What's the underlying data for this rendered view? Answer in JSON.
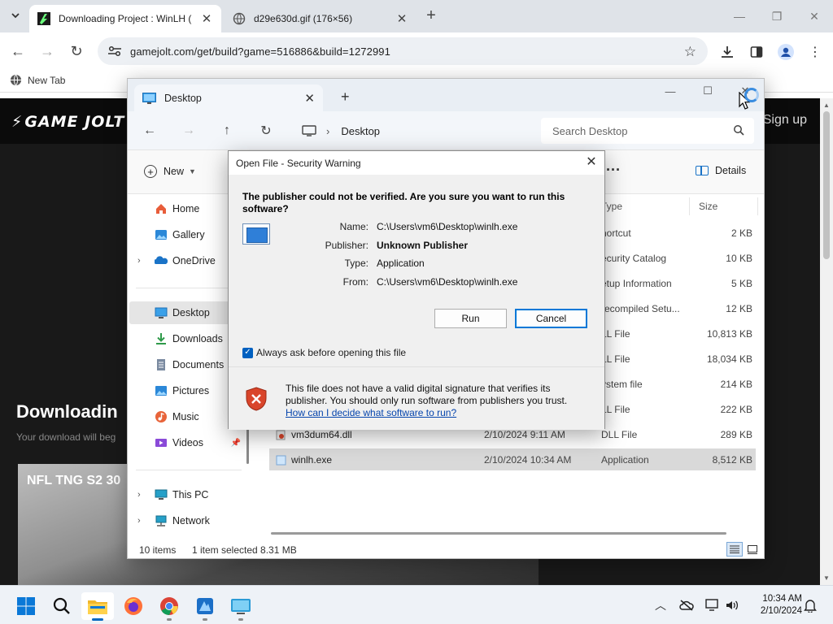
{
  "browser": {
    "tabs": [
      {
        "title": "Downloading Project : WinLH (",
        "active": true,
        "favicon": "gamejolt-icon"
      },
      {
        "title": "d29e630d.gif (176×56)",
        "active": false,
        "favicon": "globe-icon"
      }
    ],
    "url": "gamejolt.com/get/build?game=516886&build=1272991",
    "bookmarks": [
      "New Tab"
    ]
  },
  "webpage": {
    "logo": "GAME JOLT",
    "signin": "Sign up",
    "heading": "Downloadin",
    "subtitle": "Your download will beg",
    "video_title": "NFL TNG S2 30"
  },
  "explorer": {
    "tab_title": "Desktop",
    "breadcrumb": "Desktop",
    "search_placeholder": "Search Desktop",
    "new_label": "New",
    "details_label": "Details",
    "columns": {
      "type": "Type",
      "size": "Size"
    },
    "sidebar": [
      {
        "label": "Home",
        "icon": "home-icon"
      },
      {
        "label": "Gallery",
        "icon": "gallery-icon"
      },
      {
        "label": "OneDrive",
        "icon": "onedrive-icon",
        "expandable": true
      },
      {
        "label": "Desktop",
        "icon": "desktop-icon",
        "selected": true
      },
      {
        "label": "Downloads",
        "icon": "downloads-icon"
      },
      {
        "label": "Documents",
        "icon": "documents-icon"
      },
      {
        "label": "Pictures",
        "icon": "pictures-icon"
      },
      {
        "label": "Music",
        "icon": "music-icon"
      },
      {
        "label": "Videos",
        "icon": "videos-icon"
      },
      {
        "label": "This PC",
        "icon": "pc-icon",
        "expandable": true
      },
      {
        "label": "Network",
        "icon": "network-icon",
        "expandable": true
      }
    ],
    "files": [
      {
        "name": "",
        "date": "",
        "type": "hortcut",
        "size": "2 KB"
      },
      {
        "name": "",
        "date": "",
        "type": "ecurity Catalog",
        "size": "10 KB"
      },
      {
        "name": "",
        "date": "",
        "type": "etup Information",
        "size": "5 KB"
      },
      {
        "name": "",
        "date": "",
        "type": "recompiled Setu...",
        "size": "12 KB"
      },
      {
        "name": "",
        "date": "",
        "type": "LL File",
        "size": "10,813 KB"
      },
      {
        "name": "",
        "date": "",
        "type": "LL File",
        "size": "18,034 KB"
      },
      {
        "name": "",
        "date": "",
        "type": "ystem file",
        "size": "214 KB"
      },
      {
        "name": "",
        "date": "",
        "type": "LL File",
        "size": "222 KB"
      },
      {
        "name": "vm3dum64.dll",
        "date": "2/10/2024 9:11 AM",
        "type": "DLL File",
        "size": "289 KB"
      },
      {
        "name": "winlh.exe",
        "date": "2/10/2024 10:34 AM",
        "type": "Application",
        "size": "8,512 KB",
        "selected": true
      }
    ],
    "status_count": "10 items",
    "status_selection": "1 item selected  8.31 MB"
  },
  "dialog": {
    "title": "Open File - Security Warning",
    "question": "The publisher could not be verified.  Are you sure you want to run this software?",
    "fields": [
      {
        "key": "Name:",
        "value": "C:\\Users\\vm6\\Desktop\\winlh.exe",
        "bold": false
      },
      {
        "key": "Publisher:",
        "value": "Unknown Publisher",
        "bold": true
      },
      {
        "key": "Type:",
        "value": "Application",
        "bold": false
      },
      {
        "key": "From:",
        "value": "C:\\Users\\vm6\\Desktop\\winlh.exe",
        "bold": false
      }
    ],
    "run_label": "Run",
    "cancel_label": "Cancel",
    "checkbox_label": "Always ask before opening this file",
    "checkbox_checked": true,
    "note": "This file does not have a valid digital signature that verifies its publisher.  You should only run software from publishers you trust.",
    "link": "How can I decide what software to run?"
  },
  "taskbar": {
    "apps": [
      "start-icon",
      "search-icon",
      "file-explorer-icon",
      "firefox-icon",
      "chrome-icon",
      "app-icon",
      "explorer-app-icon"
    ],
    "time": "10:34 AM",
    "date": "2/10/2024"
  }
}
